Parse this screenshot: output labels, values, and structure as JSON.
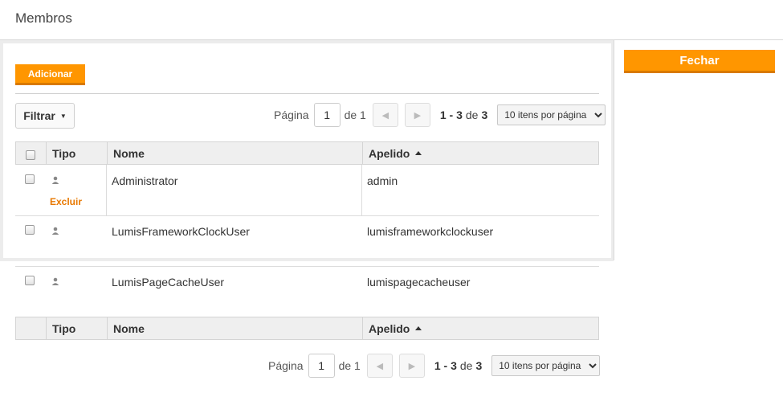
{
  "header": {
    "title": "Membros"
  },
  "actions": {
    "add_label": "Adicionar",
    "close_label": "Fechar"
  },
  "filter": {
    "label": "Filtrar"
  },
  "pager": {
    "page_label": "Página",
    "page_value": "1",
    "of_label": "de 1",
    "range": "1 - 3",
    "range_of": "de",
    "total": "3",
    "per_page": "10 itens por página"
  },
  "table": {
    "columns": {
      "type": "Tipo",
      "name": "Nome",
      "lastname": "Apelido"
    },
    "rows": [
      {
        "name": "Administrator",
        "lastname": "admin",
        "action": "Excluir"
      },
      {
        "name": "LumisFrameworkClockUser",
        "lastname": "lumisframeworkclockuser"
      },
      {
        "name": "LumisPageCacheUser",
        "lastname": "lumispagecacheuser"
      }
    ]
  },
  "icons": {
    "user": "user-icon",
    "prev": "prev-page-icon",
    "next": "next-page-icon",
    "sort": "sort-ascending-icon",
    "caret": "chevron-down-icon"
  },
  "colors": {
    "accent": "#ff9600",
    "link": "#e87800"
  }
}
